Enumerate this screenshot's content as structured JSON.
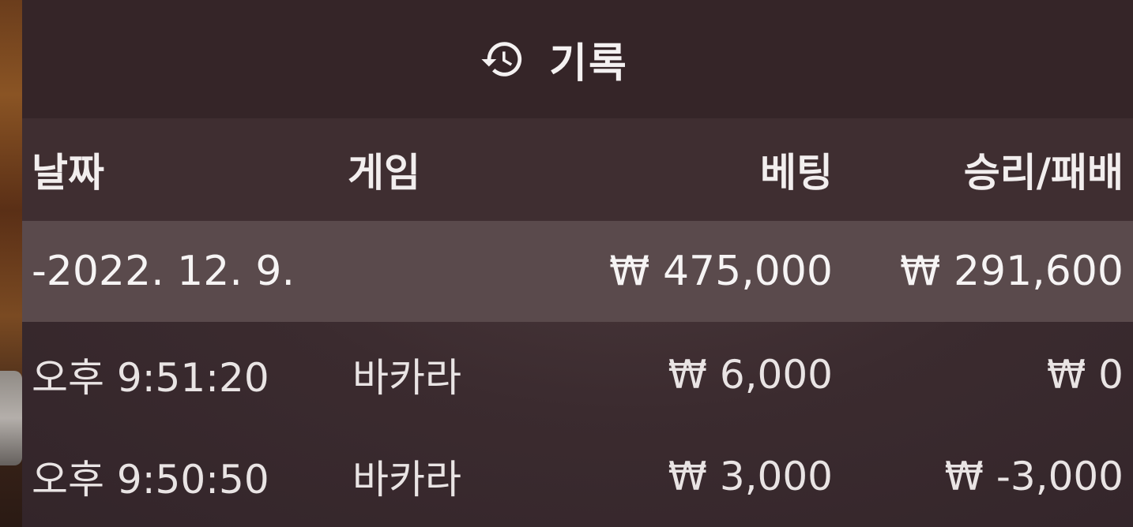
{
  "header": {
    "title": "기록",
    "icon": "history-icon"
  },
  "table": {
    "columns": {
      "date": "날짜",
      "game": "게임",
      "bet": "베팅",
      "win_loss": "승리/패배"
    },
    "summary": {
      "date": "-2022. 12. 9.",
      "game": "",
      "bet": "₩ 475,000",
      "win_loss": "₩ 291,600"
    },
    "rows": [
      {
        "time": "오후 9:51:20",
        "game": "바카라",
        "bet": "₩ 6,000",
        "win_loss": "₩ 0"
      },
      {
        "time": "오후 9:50:50",
        "game": "바카라",
        "bet": "₩ 3,000",
        "win_loss": "₩ -3,000"
      }
    ]
  },
  "colors": {
    "header_bg": "#352528",
    "table_header_bg": "#3f2e31",
    "summary_row_bg": "#5a4a4c",
    "panel_bg": "#3b2b2f",
    "text": "#efecec"
  }
}
